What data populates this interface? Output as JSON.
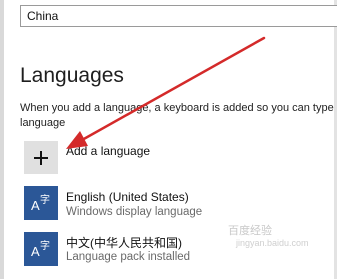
{
  "country": {
    "value": "China"
  },
  "languages": {
    "heading": "Languages",
    "description_line1": "When you add a language, a keyboard is added so you can type in",
    "description_line2": "language",
    "add_label": "Add a language",
    "items": [
      {
        "name": "English (United States)",
        "status": "Windows display language",
        "icon": "language-icon"
      },
      {
        "name": "中文(中华人民共和国)",
        "status": "Language pack installed",
        "icon": "language-icon"
      }
    ]
  },
  "colors": {
    "tile_blue": "#2b5797",
    "arrow_red": "#d42a2a",
    "add_tile": "#e0e0e0"
  },
  "watermark": {
    "line1": "百度经验",
    "line2": "jingyan.baidu.com"
  }
}
